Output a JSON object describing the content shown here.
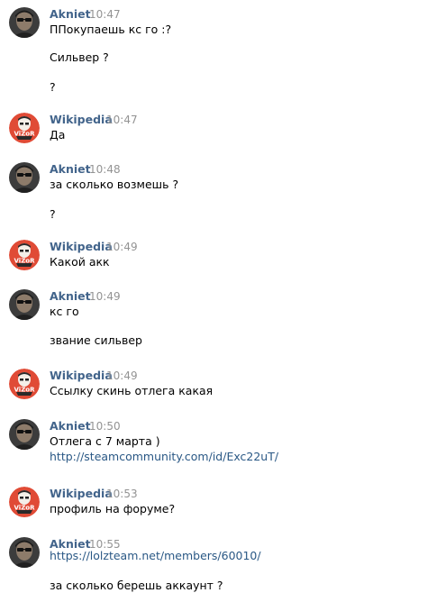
{
  "colors": {
    "author": "#42648b",
    "time": "#939393",
    "text": "#000000",
    "link": "#2a5885"
  },
  "messages": [
    {
      "author": "Akniet",
      "time": "10:47",
      "avatar": "person-avatar-icon",
      "lines": [
        "ППокупаешь кс го :?",
        "Сильвер ?",
        "?"
      ]
    },
    {
      "author": "Wikipedia",
      "time": "10:47",
      "avatar": "vizor-logo-avatar-icon",
      "lines": [
        "Да"
      ]
    },
    {
      "author": "Akniet",
      "time": "10:48",
      "avatar": "person-avatar-icon",
      "lines": [
        "за сколько возмешь ?",
        "?"
      ]
    },
    {
      "author": "Wikipedia",
      "time": "10:49",
      "avatar": "vizor-logo-avatar-icon",
      "lines": [
        "Какой акк"
      ]
    },
    {
      "author": "Akniet",
      "time": "10:49",
      "avatar": "person-avatar-icon",
      "lines": [
        "кс го",
        "звание сильвер"
      ]
    },
    {
      "author": "Wikipedia",
      "time": "10:49",
      "avatar": "vizor-logo-avatar-icon",
      "lines": [
        "Ссылку скинь отлега какая"
      ]
    },
    {
      "author": "Akniet",
      "time": "10:50",
      "avatar": "person-avatar-icon",
      "lines": [
        "Отлега с 7 марта )",
        "http://steamcommunity.com/id/Exc22uT/"
      ]
    },
    {
      "author": "Wikipedia",
      "time": "10:53",
      "avatar": "vizor-logo-avatar-icon",
      "lines": [
        "профиль на форуме?"
      ]
    },
    {
      "author": "Akniet",
      "time": "10:55",
      "avatar": "person-avatar-icon",
      "lines": [
        "https://lolzteam.net/members/60010/",
        "за сколько берешь аккаунт ?"
      ]
    }
  ]
}
